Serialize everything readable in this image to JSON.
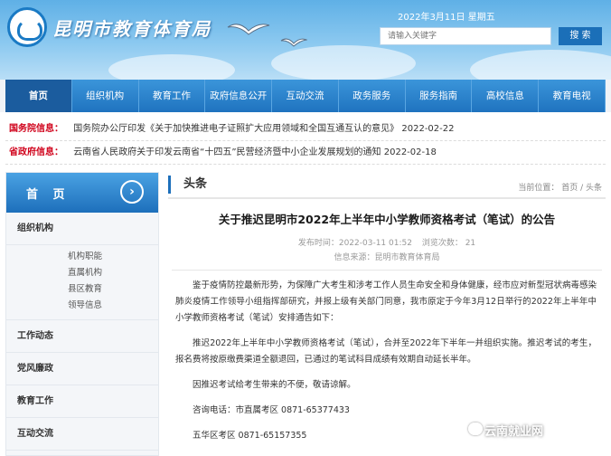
{
  "header": {
    "site_name": "昆明市教育体育局",
    "date": "2022年3月11日 星期五",
    "search_placeholder": "请输入关键字",
    "search_button": "搜 索"
  },
  "nav": {
    "items": [
      "首页",
      "组织机构",
      "教育工作",
      "政府信息公开",
      "互动交流",
      "政务服务",
      "服务指南",
      "高校信息",
      "教育电视"
    ]
  },
  "notices": [
    {
      "tag": "国务院信息：",
      "text": "国务院办公厅印发《关于加快推进电子证照扩大应用领域和全国互通互认的意见》  2022-02-22"
    },
    {
      "tag": "省政府信息：",
      "text": "云南省人民政府关于印发云南省“十四五”民营经济暨中小企业发展规划的通知  2022-02-18"
    }
  ],
  "sidebar": {
    "home_label": "首 页",
    "home_arrow": "›",
    "group_org": "组织机构",
    "org_items": [
      "机构职能",
      "直属机构",
      "县区教育",
      "领导信息"
    ],
    "groups": [
      "工作动态",
      "党风廉政",
      "教育工作",
      "互动交流"
    ]
  },
  "main": {
    "section_title": "头条",
    "breadcrumb": "当前位置： 首页 / 头条",
    "article": {
      "title": "关于推迟昆明市2022年上半年中小学教师资格考试（笔试）的公告",
      "published": "发布时间：2022-03-11 01:52",
      "views": "浏览次数： 21",
      "source": "信息来源：昆明市教育体育局",
      "paragraphs": [
        "鉴于疫情防控最新形势，为保障广大考生和涉考工作人员生命安全和身体健康，经市应对新型冠状病毒感染肺炎疫情工作领导小组指挥部研究，并报上级有关部门同意，我市原定于今年3月12日举行的2022年上半年中小学教师资格考试（笔试）安排通告如下：",
        "推迟2022年上半年中小学教师资格考试（笔试），合并至2022年下半年一并组织实施。推迟考试的考生，报名费将按原缴费渠道全额退回，已通过的笔试科目成绩有效期自动延长半年。",
        "因推迟考试给考生带来的不便，敬请谅解。",
        "咨询电话：市直属考区   0871-65377433",
        "五华区考区   0871-65157355"
      ]
    }
  },
  "watermark": "云南就业网"
}
